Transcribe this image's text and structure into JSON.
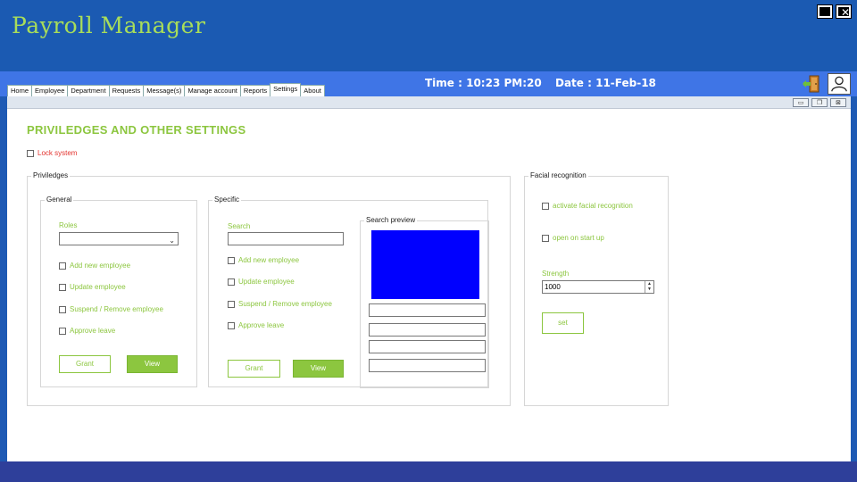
{
  "window": {
    "title": "Payroll Manager"
  },
  "menu": {
    "tabs": [
      "Home",
      "Employee",
      "Department",
      "Requests",
      "Message(s)",
      "Manage account",
      "Reports",
      "Settings",
      "About"
    ],
    "active_tab": "Settings"
  },
  "status": {
    "time": "Time : 10:23 PM:20",
    "date": "Date : 11-Feb-18"
  },
  "icons": {
    "exit": "exit-door-icon",
    "user": "user-icon"
  },
  "page": {
    "heading": "PRIVILEDGES AND OTHER SETTINGS",
    "lock_label": "Lock system"
  },
  "privileges": {
    "legend": "Priviledges",
    "general": {
      "legend": "General",
      "roles_label": "Roles",
      "roles_value": "",
      "checks": [
        "Add new employee",
        "Update employee",
        "Suspend / Remove employee",
        "Approve leave"
      ],
      "grant_label": "Grant",
      "view_label": "View"
    },
    "specific": {
      "legend": "Specific",
      "search_label": "Search",
      "search_value": "",
      "checks": [
        "Add new employee",
        "Update employee",
        "Suspend / Remove employee",
        "Approve leave"
      ],
      "grant_label": "Grant",
      "view_label": "View",
      "preview_legend": "Search preview",
      "preview_color": "#0000ff"
    }
  },
  "facial": {
    "legend": "Facial recognition",
    "activate_label": "activate facial recognition",
    "startup_label": "open on start up",
    "strength_label": "Strength",
    "strength_value": "1000",
    "set_label": "set"
  },
  "colors": {
    "accent": "#8cc63f",
    "titlebar": "#1b5ab2",
    "menubar": "#3f75e6",
    "warning": "#e3342f"
  }
}
